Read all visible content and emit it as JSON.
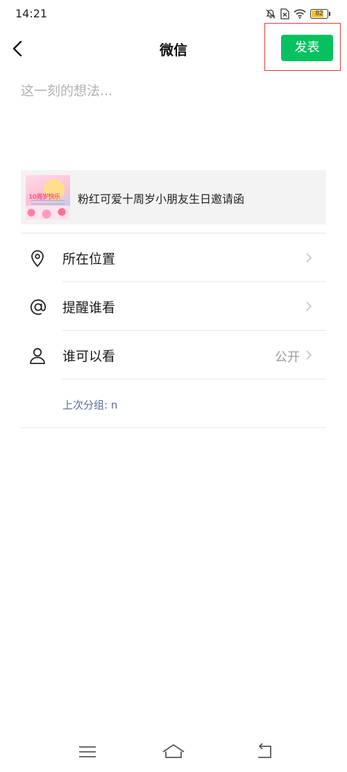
{
  "status_bar": {
    "time": "14:21",
    "battery_level": "82",
    "battery_fraction": 0.82,
    "icons": [
      "bell-off-icon",
      "sim-x-icon",
      "wifi-icon",
      "battery-icon"
    ]
  },
  "header": {
    "title": "微信",
    "back_icon": "chevron-left-icon",
    "publish_label": "发表",
    "publish_color": "#07c160",
    "highlight_color": "#e53935"
  },
  "post": {
    "placeholder": "这一刻的想法...",
    "value": ""
  },
  "shared_link": {
    "title": "粉红可爱十周岁小朋友生日邀请函",
    "thumbnail_text": "10周岁快乐"
  },
  "options": [
    {
      "icon": "location-pin-icon",
      "label": "所在位置",
      "value": ""
    },
    {
      "icon": "at-sign-icon",
      "label": "提醒谁看",
      "value": ""
    },
    {
      "icon": "person-icon",
      "label": "谁可以看",
      "value": "公开"
    }
  ],
  "last_group": {
    "text": "上次分组: n",
    "color": "#576b95"
  },
  "nav": {
    "icons": [
      "menu-icon",
      "home-icon",
      "back-icon"
    ]
  }
}
